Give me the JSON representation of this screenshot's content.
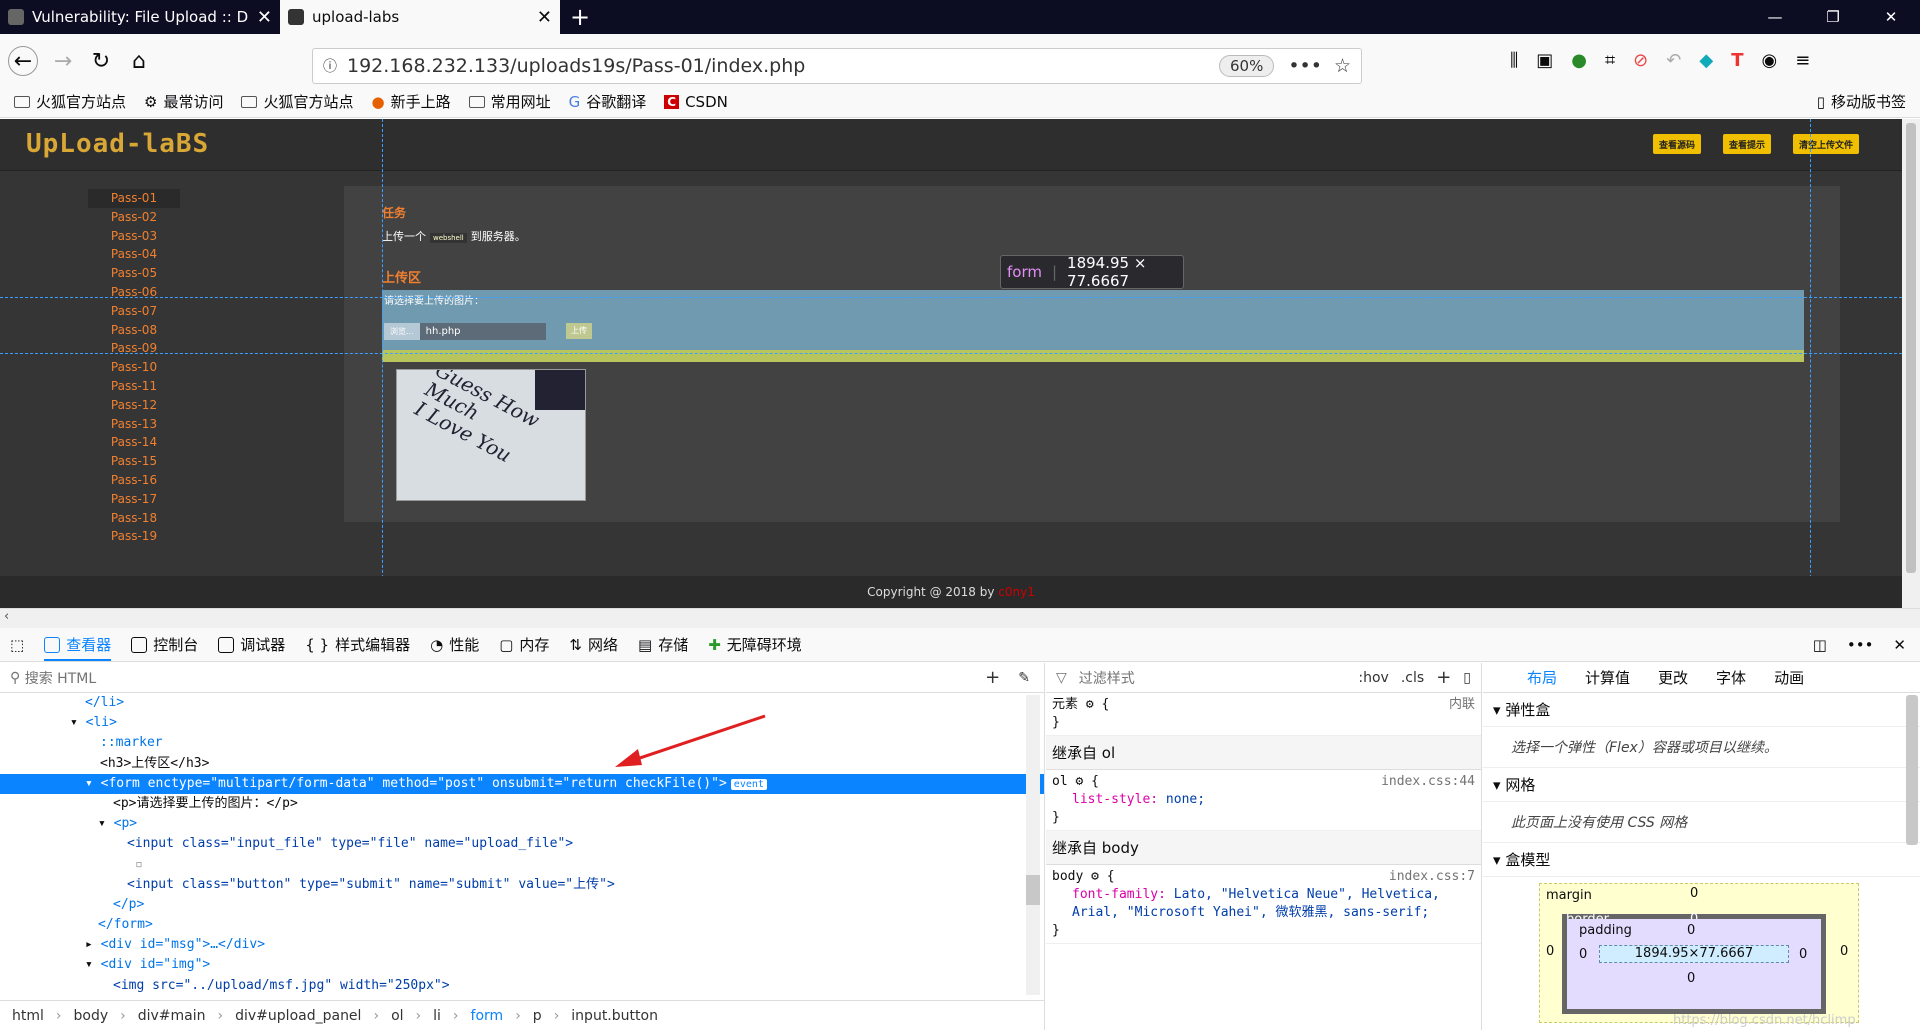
{
  "browser": {
    "tabs": [
      {
        "title": "Vulnerability: File Upload :: D"
      },
      {
        "title": "upload-labs"
      }
    ],
    "url": "192.168.232.133/uploads19s/Pass-01/index.php",
    "zoom": "60%",
    "bookmarks": [
      "火狐官方站点",
      "最常访问",
      "火狐官方站点",
      "新手上路",
      "常用网址",
      "谷歌翻译",
      "CSDN"
    ],
    "mobile_bookmarks": "移动版书签"
  },
  "page": {
    "logo": "UpLoad-laBS",
    "header_buttons": [
      "查看源码",
      "查看提示",
      "清空上传文件"
    ],
    "menu": [
      "Pass-01",
      "Pass-02",
      "Pass-03",
      "Pass-04",
      "Pass-05",
      "Pass-06",
      "Pass-07",
      "Pass-08",
      "Pass-09",
      "Pass-10",
      "Pass-11",
      "Pass-12",
      "Pass-13",
      "Pass-14",
      "Pass-15",
      "Pass-16",
      "Pass-17",
      "Pass-18",
      "Pass-19"
    ],
    "task_title": "任务",
    "task_text_before": "上传一个",
    "task_code": "webshell",
    "task_text_after": "到服务器。",
    "upload_title": "上传区",
    "upload_prompt": "请选择要上传的图片：",
    "browse_label": "浏览...",
    "file_name": "hh.php",
    "upload_button": "上传",
    "image_text_line1": "Guess How Much",
    "image_text_line2": "I Love You",
    "footer_text": "Copyright @ 2018 by",
    "footer_author": "c0ny1"
  },
  "tooltip": {
    "tag": "form",
    "size": "1894.95 × 77.6667"
  },
  "devtools": {
    "tabs": [
      "查看器",
      "控制台",
      "调试器",
      "样式编辑器",
      "性能",
      "内存",
      "网络",
      "存储",
      "无障碍环境"
    ],
    "search_placeholder": "搜索 HTML",
    "tree": [
      "</li>",
      "<li>",
      "::marker",
      "<h3>上传区</h3>",
      "<form enctype=\"multipart/form-data\" method=\"post\" onsubmit=\"return checkFile()\">",
      "<p>请选择要上传的图片：</p>",
      "<p>",
      "<input class=\"input_file\" type=\"file\" name=\"upload_file\">",
      "",
      "<input class=\"button\" type=\"submit\" name=\"submit\" value=\"上传\">",
      "</p>",
      "</form>",
      "<div id=\"msg\">…</div>",
      "<div id=\"img\">",
      "<img src=\"../upload/msf.jpg\" width=\"250px\">"
    ],
    "event_badge": "event",
    "breadcrumbs": [
      "html",
      "body",
      "div#main",
      "div#upload_panel",
      "ol",
      "li",
      "form",
      "p",
      "input.button"
    ],
    "filter_placeholder": "过滤样式",
    "hov": ":hov",
    "cls": ".cls",
    "element_label": "元素",
    "inline_label": "内联",
    "inherit_ol": "继承自 ol",
    "ol_source": "index.css:44",
    "ol_prop": "list-style:",
    "ol_value": "none;",
    "inherit_body": "继承自 body",
    "body_source": "index.css:7",
    "body_prop": "font-family:",
    "body_value": "Lato, \"Helvetica Neue\", Helvetica, Arial, \"Microsoft Yahei\", 微软雅黑, sans-serif;",
    "layout_tabs": [
      "布局",
      "计算值",
      "更改",
      "字体",
      "动画"
    ],
    "flex_title": "弹性盒",
    "flex_text": "选择一个弹性（Flex）容器或项目以继续。",
    "grid_title": "网格",
    "grid_text": "此页面上没有使用 CSS 网格",
    "boxmodel_title": "盒模型",
    "box": {
      "margin": "margin",
      "border": "border",
      "padding": "padding",
      "content": "1894.95×77.6667",
      "zero": "0"
    },
    "watermark": "https://blog.csdn.net/hclimp"
  }
}
